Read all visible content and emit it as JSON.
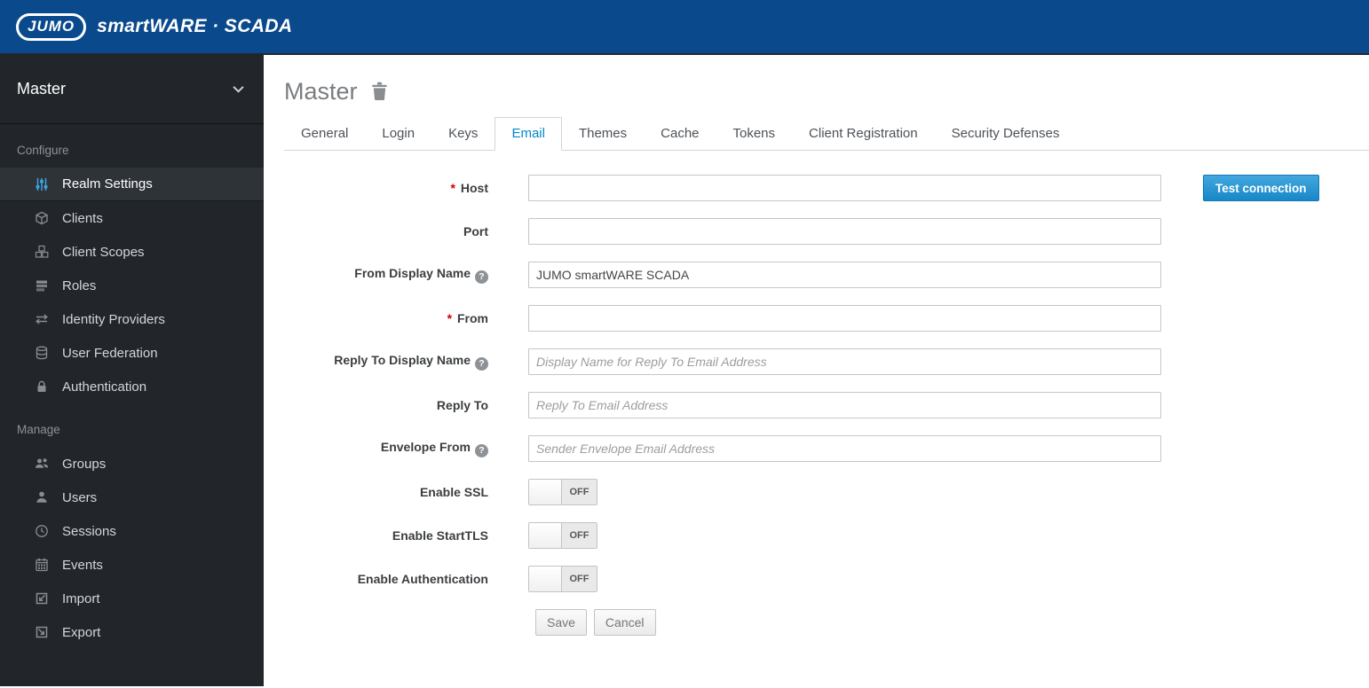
{
  "brand": {
    "logo_text": "JUMO",
    "product_name": "smartWARE · SCADA"
  },
  "sidebar": {
    "realm_selector": {
      "label": "Master"
    },
    "sections": [
      {
        "title": "Configure",
        "items": [
          {
            "label": "Realm Settings",
            "icon": "sliders",
            "active": true
          },
          {
            "label": "Clients",
            "icon": "cube"
          },
          {
            "label": "Client Scopes",
            "icon": "cubes"
          },
          {
            "label": "Roles",
            "icon": "list"
          },
          {
            "label": "Identity Providers",
            "icon": "exchange-arrows"
          },
          {
            "label": "User Federation",
            "icon": "database"
          },
          {
            "label": "Authentication",
            "icon": "lock"
          }
        ]
      },
      {
        "title": "Manage",
        "items": [
          {
            "label": "Groups",
            "icon": "group"
          },
          {
            "label": "Users",
            "icon": "user"
          },
          {
            "label": "Sessions",
            "icon": "clock"
          },
          {
            "label": "Events",
            "icon": "calendar"
          },
          {
            "label": "Import",
            "icon": "import"
          },
          {
            "label": "Export",
            "icon": "export"
          }
        ]
      }
    ]
  },
  "page": {
    "title": "Master",
    "tabs": [
      {
        "label": "General"
      },
      {
        "label": "Login"
      },
      {
        "label": "Keys"
      },
      {
        "label": "Email",
        "active": true
      },
      {
        "label": "Themes"
      },
      {
        "label": "Cache"
      },
      {
        "label": "Tokens"
      },
      {
        "label": "Client Registration"
      },
      {
        "label": "Security Defenses"
      }
    ],
    "form": {
      "required_marker": "*",
      "help_glyph": "?",
      "fields": {
        "host": {
          "label": "Host",
          "value": "",
          "required": true
        },
        "port": {
          "label": "Port",
          "value": ""
        },
        "from_display_name": {
          "label": "From Display Name",
          "value": "JUMO smartWARE SCADA",
          "help": true
        },
        "from": {
          "label": "From",
          "value": "",
          "required": true
        },
        "reply_to_display_name": {
          "label": "Reply To Display Name",
          "value": "",
          "placeholder": "Display Name for Reply To Email Address",
          "help": true
        },
        "reply_to": {
          "label": "Reply To",
          "value": "",
          "placeholder": "Reply To Email Address"
        },
        "envelope_from": {
          "label": "Envelope From",
          "value": "",
          "placeholder": "Sender Envelope Email Address",
          "help": true
        }
      },
      "toggles": {
        "enable_ssl": {
          "label": "Enable SSL",
          "state": "OFF"
        },
        "enable_starttls": {
          "label": "Enable StartTLS",
          "state": "OFF"
        },
        "enable_authentication": {
          "label": "Enable Authentication",
          "state": "OFF"
        }
      },
      "actions": {
        "test_connection": "Test connection",
        "save": "Save",
        "cancel": "Cancel"
      }
    }
  },
  "colors": {
    "header_bg": "#0a4a8c",
    "sidebar_bg": "#22262a",
    "active_tab_text": "#0088ce",
    "primary_button": "#1787c8",
    "required_red": "#cc0000"
  }
}
